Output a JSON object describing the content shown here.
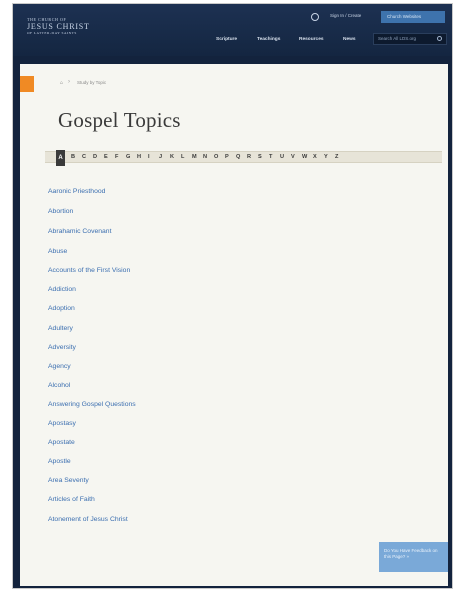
{
  "header": {
    "logo_line1": "THE CHURCH OF",
    "logo_line2": "JESUS CHRIST",
    "logo_line3": "OF LATTER-DAY SAINTS",
    "signin": "Sign In / Create",
    "top_button": "Church Websites",
    "nav": [
      "Scripture",
      "Teachings",
      "Resources",
      "News"
    ],
    "search_placeholder": "Search All LDS.org"
  },
  "breadcrumb": {
    "text": "Study by Topic"
  },
  "page_title": "Gospel Topics",
  "alphabet": {
    "active": "A",
    "letters": [
      "B",
      "C",
      "D",
      "E",
      "F",
      "G",
      "H",
      "I",
      "J",
      "K",
      "L",
      "M",
      "N",
      "O",
      "P",
      "Q",
      "R",
      "S",
      "T",
      "U",
      "V",
      "W",
      "X",
      "Y",
      "Z"
    ]
  },
  "topics": [
    "Aaronic Priesthood",
    "Abortion",
    "Abrahamic Covenant",
    "Abuse",
    "Accounts of the First Vision",
    "Addiction",
    "Adoption",
    "Adultery",
    "Adversity",
    "Agency",
    "Alcohol",
    "Answering Gospel Questions",
    "Apostasy",
    "Apostate",
    "Apostle",
    "Area Seventy",
    "Articles of Faith",
    "Atonement of Jesus Christ"
  ],
  "feedback": {
    "line1": "Do You Have Feedback on",
    "line2": "this Page? »"
  },
  "colors": {
    "header_bg": "#1a2d4b",
    "link": "#3c6fb0",
    "accent_tab": "#f08a24",
    "feedback_bg": "#7aa9d8"
  },
  "icons": [
    "globe-icon",
    "search-icon",
    "home-icon"
  ]
}
